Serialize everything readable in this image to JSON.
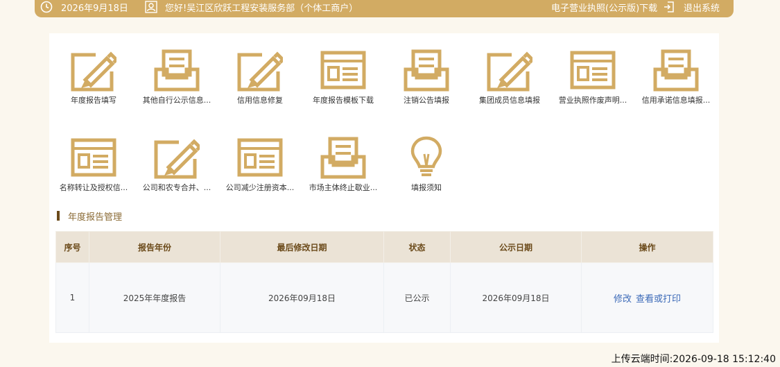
{
  "header": {
    "date": "2026年9月18日",
    "greeting": "您好!吴江区欣跃工程安装服务部（个体工商户）",
    "license_download": "电子营业执照(公示版)下载",
    "logout": "退出系统"
  },
  "tiles": [
    {
      "label": "年度报告填写",
      "icon": "pencil-icon"
    },
    {
      "label": "其他自行公示信息...",
      "icon": "inbox-icon"
    },
    {
      "label": "信用信息修复",
      "icon": "pencil-icon"
    },
    {
      "label": "年度报告模板下载",
      "icon": "window-icon"
    },
    {
      "label": "注销公告填报",
      "icon": "inbox-icon"
    },
    {
      "label": "集团成员信息填报",
      "icon": "pencil-icon"
    },
    {
      "label": "营业执照作废声明...",
      "icon": "window-icon"
    },
    {
      "label": "信用承诺信息填报...",
      "icon": "inbox-icon"
    },
    {
      "label": "名称转让及授权信...",
      "icon": "window-icon"
    },
    {
      "label": "公司和农专合并、...",
      "icon": "pencil-icon"
    },
    {
      "label": "公司减少注册资本...",
      "icon": "window-icon"
    },
    {
      "label": "市场主体终止歇业...",
      "icon": "inbox-icon"
    },
    {
      "label": "填报须知",
      "icon": "lightbulb-icon"
    }
  ],
  "section": {
    "title": "年度报告管理"
  },
  "table": {
    "headers": [
      "序号",
      "报告年份",
      "最后修改日期",
      "状态",
      "公示日期",
      "操作"
    ],
    "rows": [
      {
        "index": "1",
        "year": "2025年年度报告",
        "modified": "2026年09月18日",
        "status": "已公示",
        "published": "2026年09月18日",
        "op_edit": "修改",
        "op_view": "查看或打印"
      }
    ]
  },
  "footer": {
    "upload_time": "上传云端时间:2026-09-18 15:12:40"
  },
  "colors": {
    "accent": "#d2ab63",
    "header_text": "#6b4a1a",
    "link": "#3c6ab8"
  }
}
